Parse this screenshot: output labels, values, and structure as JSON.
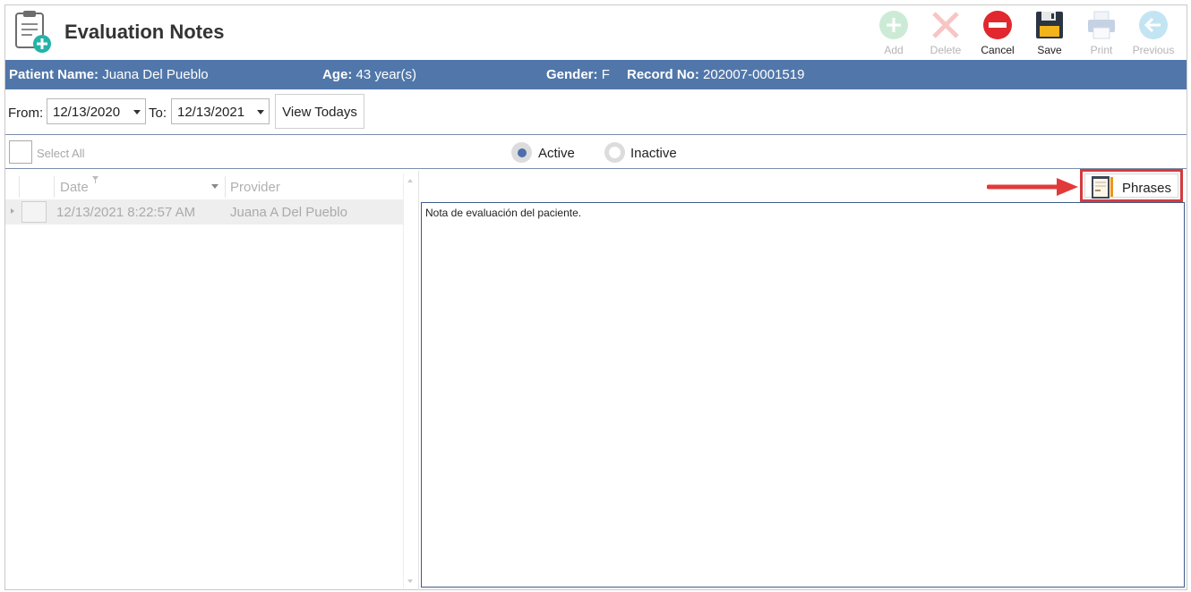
{
  "header": {
    "title": "Evaluation Notes"
  },
  "toolbar": {
    "add_label": "Add",
    "delete_label": "Delete",
    "cancel_label": "Cancel",
    "save_label": "Save",
    "print_label": "Print",
    "previous_label": "Previous"
  },
  "patient": {
    "name_label": "Patient Name:",
    "name_value": "Juana Del Pueblo",
    "age_label": "Age:",
    "age_value": "43 year(s)",
    "gender_label": "Gender:",
    "gender_value": "F",
    "record_label": "Record No:",
    "record_value": "202007-0001519"
  },
  "filter": {
    "from_label": "From:",
    "from_value": "12/13/2020",
    "to_label": "To:",
    "to_value": "12/13/2021",
    "view_button": "View Todays"
  },
  "selection": {
    "select_all": "Select All",
    "active_label": "Active",
    "inactive_label": "Inactive",
    "selected": "Active"
  },
  "grid": {
    "columns": [
      "Date",
      "Provider"
    ],
    "rows": [
      {
        "date": "12/13/2021 8:22:57 AM",
        "provider": "Juana A Del Pueblo"
      }
    ]
  },
  "phrases_button": "Phrases",
  "note_text": "Nota de evaluación del paciente.",
  "colors": {
    "patient_bar": "#5177aa",
    "accent_red": "#d43a3e",
    "active_radio": "#4e6fab"
  }
}
